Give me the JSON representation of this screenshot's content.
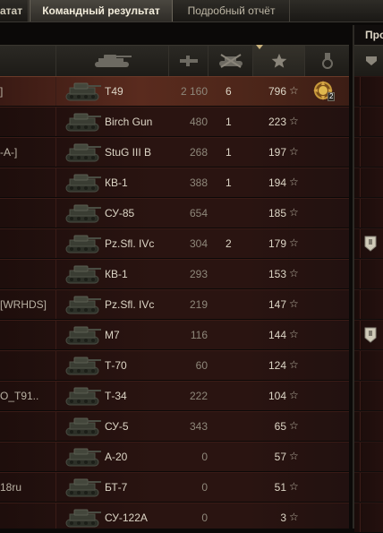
{
  "tabs": [
    {
      "label": "атат",
      "active": false
    },
    {
      "label": "Командный результат",
      "active": true
    },
    {
      "label": "Подробный отчёт",
      "active": false
    }
  ],
  "columns": [
    {
      "name": "vehicle",
      "icon": "tank-icon"
    },
    {
      "name": "damage",
      "icon": "damage-icon"
    },
    {
      "name": "kills",
      "icon": "destroyed-tank-icon"
    },
    {
      "name": "experience",
      "icon": "star-icon",
      "sorted": true
    },
    {
      "name": "medals",
      "icon": "medal-icon"
    }
  ],
  "star": "☆",
  "rows": [
    {
      "player": "]",
      "vehicle": "T49",
      "damage": "2 160",
      "kills": "6",
      "xp": "796",
      "medal": true,
      "medal_count": "2",
      "highlight": true
    },
    {
      "player": "",
      "vehicle": "Birch Gun",
      "damage": "480",
      "kills": "1",
      "xp": "223"
    },
    {
      "player": "-A-]",
      "vehicle": "StuG III B",
      "damage": "268",
      "kills": "1",
      "xp": "197"
    },
    {
      "player": "",
      "vehicle": "КВ-1",
      "damage": "388",
      "kills": "1",
      "xp": "194"
    },
    {
      "player": "",
      "vehicle": "СУ-85",
      "damage": "654",
      "kills": "",
      "xp": "185"
    },
    {
      "player": "",
      "vehicle": "Pz.Sfl. IVc",
      "damage": "304",
      "kills": "2",
      "xp": "179"
    },
    {
      "player": "",
      "vehicle": "КВ-1",
      "damage": "293",
      "kills": "",
      "xp": "153"
    },
    {
      "player": "[WRHDS]",
      "vehicle": "Pz.Sfl. IVc",
      "damage": "219",
      "kills": "",
      "xp": "147"
    },
    {
      "player": "",
      "vehicle": "M7",
      "damage": "116",
      "kills": "",
      "xp": "144"
    },
    {
      "player": "",
      "vehicle": "Т-70",
      "damage": "60",
      "kills": "",
      "xp": "124"
    },
    {
      "player": "O_T91..",
      "vehicle": "Т-34",
      "damage": "222",
      "kills": "",
      "xp": "104"
    },
    {
      "player": "",
      "vehicle": "СУ-5",
      "damage": "343",
      "kills": "",
      "xp": "65"
    },
    {
      "player": "",
      "vehicle": "А-20",
      "damage": "0",
      "kills": "",
      "xp": "57"
    },
    {
      "player": "18ru",
      "vehicle": "БТ-7",
      "damage": "0",
      "kills": "",
      "xp": "51"
    },
    {
      "player": "",
      "vehicle": "СУ-122А",
      "damage": "0",
      "kills": "",
      "xp": "3"
    }
  ],
  "right_panel": {
    "title": "Про",
    "badge_rows": [
      5,
      8
    ]
  }
}
